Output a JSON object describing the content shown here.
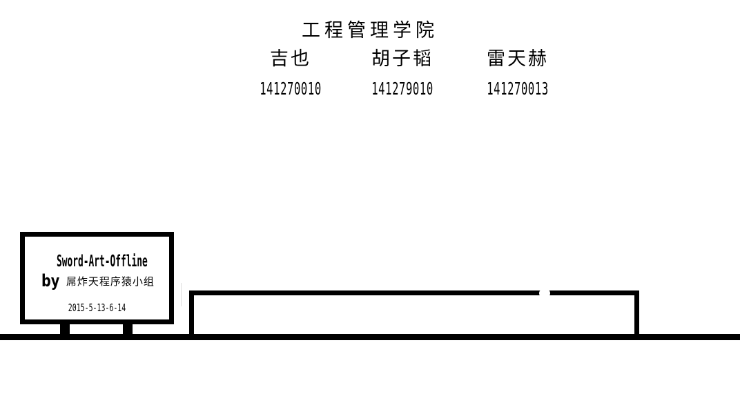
{
  "credits": {
    "school": "工程管理学院",
    "members": [
      {
        "name": "吉也",
        "id": "141270010"
      },
      {
        "name": "胡子韬",
        "id": "141279010"
      },
      {
        "name": "雷天赫",
        "id": "141270013"
      }
    ]
  },
  "sign": {
    "title": "Sword-Art-Offline",
    "by": "by",
    "team": "屌炸天程序猿小组",
    "date": "2015-5-13-6-14"
  },
  "colors": {
    "background": "#ffffff",
    "ink": "#000000"
  }
}
